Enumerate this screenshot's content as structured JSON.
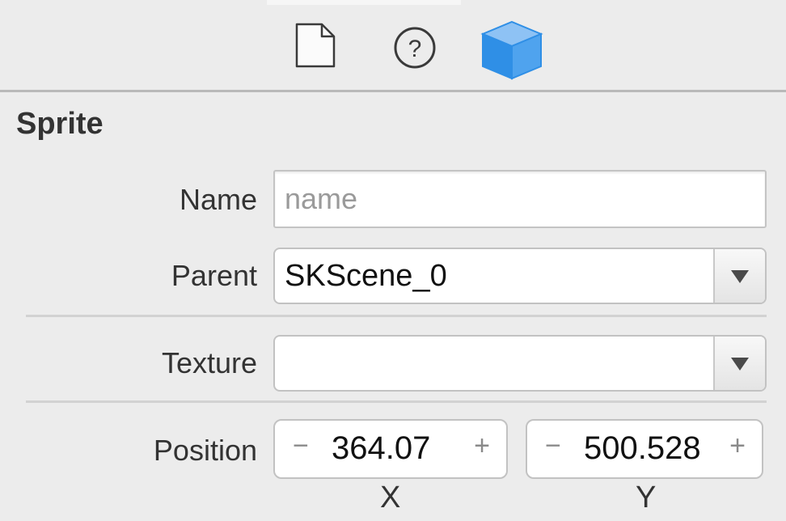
{
  "toolbar": {
    "icons": [
      "file-inspector-icon",
      "quick-help-icon",
      "node-inspector-cube-icon"
    ],
    "accent_color": "#2f8fe6"
  },
  "section": {
    "title": "Sprite",
    "name": {
      "label": "Name",
      "value": "",
      "placeholder": "name"
    },
    "parent": {
      "label": "Parent",
      "value": "SKScene_0"
    },
    "texture": {
      "label": "Texture",
      "value": ""
    },
    "position": {
      "label": "Position",
      "x": {
        "value": "364.07",
        "axis_label": "X",
        "decrement": "−",
        "increment": "+"
      },
      "y": {
        "value": "500.528",
        "axis_label": "Y",
        "decrement": "−",
        "increment": "+"
      }
    }
  }
}
